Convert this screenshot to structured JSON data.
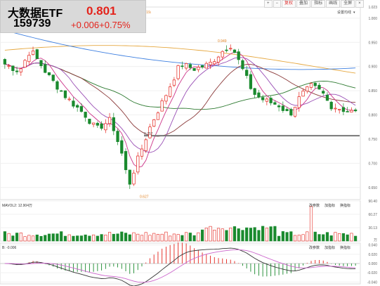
{
  "quote": {
    "name": "大数据ETF",
    "code": "159739",
    "price": "0.801",
    "change": "+0.006+0.75%"
  },
  "toolbar": [
    "+",
    "−",
    "复权",
    "叠加",
    "指标",
    "画线",
    "全屏",
    "×"
  ],
  "toolbar_active": 2,
  "colors": {
    "up": "#e4231b",
    "down": "#1a8a2e",
    "ma5": "#cc3388",
    "ma10": "#9a4fb5",
    "ma20": "#8b3a3a",
    "ma60": "#2d7a30",
    "ma120": "#3d7fe0",
    "ma250": "#e6a840",
    "dif": "#333333",
    "dea": "#cc66cc"
  },
  "labels": {
    "settings": "设置均线",
    "high_price": "0.949",
    "low_price": "0.627",
    "top_clip": ".919",
    "ref_line": "0.757",
    "vol_legend": "MAVOL2: 12.904万",
    "vol_buttons": [
      "改参数",
      "加指标",
      "换指标"
    ],
    "macd_legend": "B: -0.006",
    "macd_buttons": [
      "改参数",
      "加指标",
      "换指标"
    ]
  },
  "chart_data": [
    {
      "type": "candlestick",
      "y_ticks": [
        "1.023",
        "1.000",
        "0.950",
        "0.900",
        "0.850",
        "0.800",
        "0.750",
        "0.700",
        "0.650"
      ],
      "ylim": [
        0.625,
        1.023
      ],
      "reference_line": 0.757,
      "annotations": [
        {
          "label": "0.949",
          "value": 0.949
        },
        {
          "label": "0.627",
          "value": 0.627
        }
      ]
    },
    {
      "type": "bar",
      "name": "MAVOL2",
      "y_ticks": [
        "90.40",
        "60.27",
        "30.13",
        "万"
      ],
      "ylim": [
        0,
        90.4
      ]
    },
    {
      "type": "bar",
      "name": "MACD",
      "y_ticks": [
        "0.040",
        "0.020",
        "0.000",
        "-0.020",
        "-0.040"
      ],
      "ylim": [
        -0.044,
        0.044
      ]
    }
  ]
}
